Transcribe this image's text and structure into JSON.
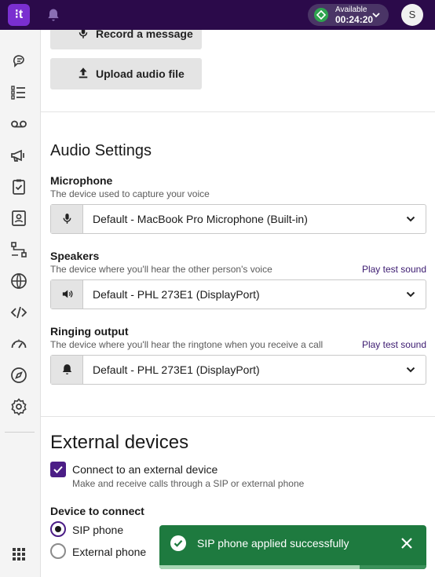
{
  "topbar": {
    "logo_text": "⁝t",
    "status_label": "Available",
    "status_time": "00:24:20",
    "status_color": "#2ea44f",
    "avatar_initial": "S"
  },
  "sidebar": {
    "items": [
      "conversations-icon",
      "list-icon",
      "voicemail-icon",
      "campaign-icon",
      "tasks-icon",
      "contacts-icon",
      "workflows-icon",
      "globe-icon",
      "code-icon",
      "dashboard-icon",
      "compass-icon",
      "settings-icon"
    ],
    "apps_icon": "apps-grid-icon"
  },
  "audio_buttons": {
    "record_label": "Record a message",
    "upload_label": "Upload audio file"
  },
  "audio_settings": {
    "title": "Audio Settings",
    "microphone": {
      "label": "Microphone",
      "description": "The device used to capture your voice",
      "value": "Default - MacBook Pro Microphone (Built-in)"
    },
    "speakers": {
      "label": "Speakers",
      "description": "The device where you'll hear the other person's voice",
      "test_link": "Play test sound",
      "value": "Default - PHL 273E1 (DisplayPort)"
    },
    "ringing": {
      "label": "Ringing output",
      "description": "The device where you'll hear the ringtone when you receive a call",
      "test_link": "Play test sound",
      "value": "Default - PHL 273E1 (DisplayPort)"
    }
  },
  "external_devices": {
    "title": "External devices",
    "checkbox_label": "Connect to an external device",
    "checkbox_checked": true,
    "checkbox_description": "Make and receive calls through a SIP or external phone",
    "device_label": "Device to connect",
    "options": [
      {
        "label": "SIP phone",
        "selected": true
      },
      {
        "label": "External phone",
        "selected": false
      }
    ]
  },
  "toast": {
    "message": "SIP phone applied successfully",
    "progress": 0.75,
    "color": "#1e7a3f"
  },
  "colors": {
    "topbar": "#2b0a4a",
    "accent": "#4b1d86",
    "link": "#3b1a70"
  }
}
